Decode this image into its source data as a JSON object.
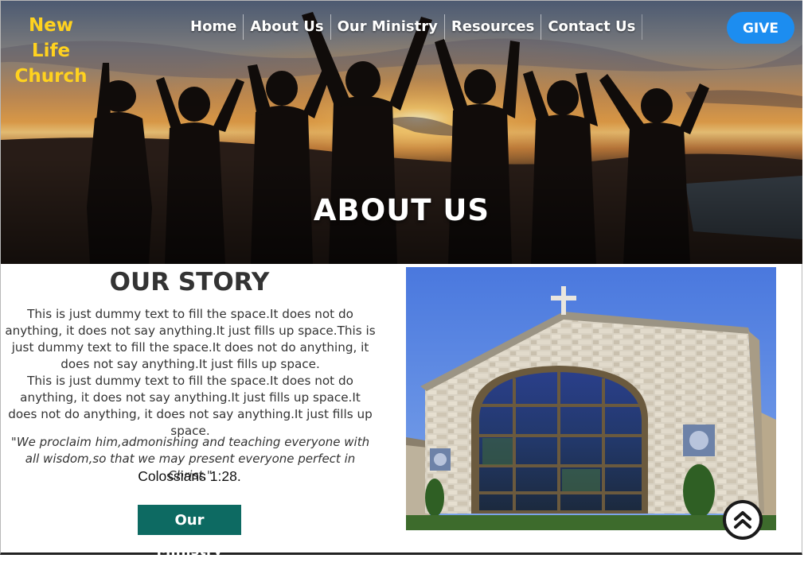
{
  "header": {
    "brand_line1": "New Life",
    "brand_line2": "Church",
    "nav": [
      "Home",
      "About Us",
      "Our Ministry",
      "Resources",
      "Contact Us"
    ],
    "give_label": "GIVE"
  },
  "hero": {
    "title": "ABOUT US"
  },
  "story": {
    "title": "OUR STORY",
    "paragraph1": "This is just dummy text to fill the space.It does not do anything, it does not say anything.It just fills up space.This is just dummy text to fill the space.It does not do anything, it does not say anything.It just fills up space.",
    "paragraph2": "This is just dummy text to fill the space.It does not do anything, it does not say anything.It just fills up space.It does not do anything, it does not say anything.It just fills up space.",
    "quote": "\"We proclaim him,admonishing and teaching everyone with all wisdom,so that we may present everyone perfect in Christ.\"",
    "verse": "Colossians 1:28.",
    "button_label": "Our Ministry"
  },
  "colors": {
    "brand": "#ffd21f",
    "give_button": "#1c8df0",
    "ministry_button": "#0d6a62"
  },
  "icons": {
    "scroll_top": "double-chevron-up-icon"
  }
}
